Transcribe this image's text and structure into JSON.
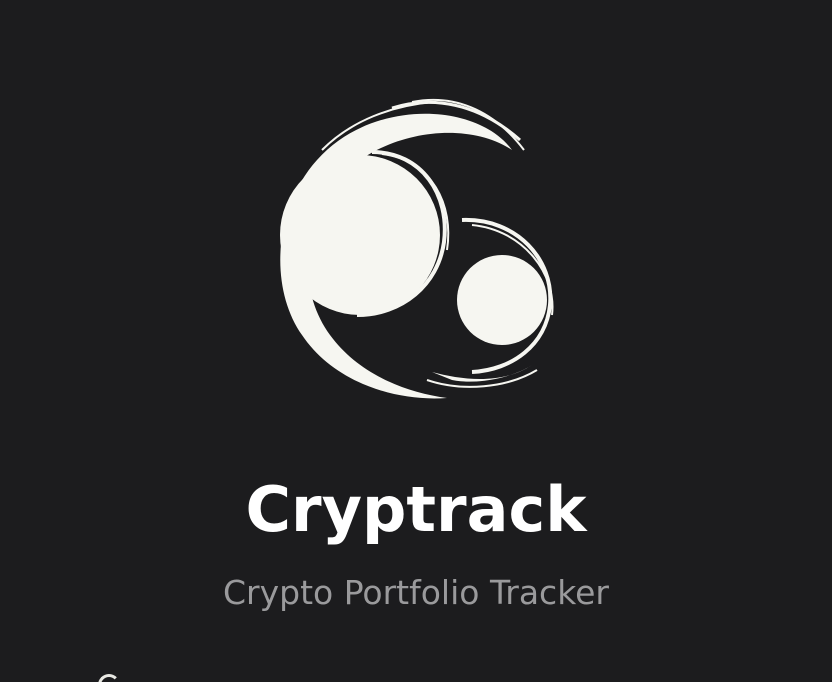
{
  "app": {
    "name": "Cryptrack",
    "tagline": "Crypto Portfolio Tracker"
  },
  "logo": {
    "icon": "brush-stroke-circles-logo-icon"
  },
  "colors": {
    "background": "#1c1c1e",
    "logo": "#f6f6f1",
    "title": "#ffffff",
    "tagline": "#9a9a9c"
  }
}
